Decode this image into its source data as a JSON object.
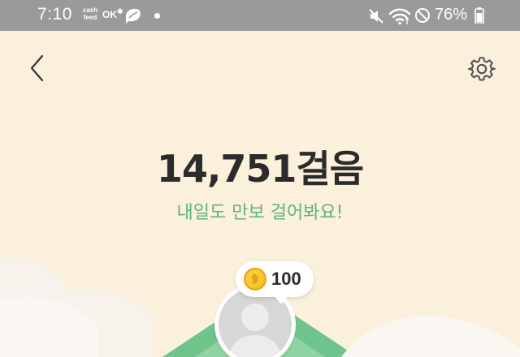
{
  "status_bar": {
    "time": "7:10",
    "cashfeed_line1": "cash",
    "cashfeed_line2": "feed",
    "ok_label": "OK",
    "battery": "76%",
    "icons": [
      "cashfeed-icon",
      "ok-cashbag-icon",
      "leaf-icon",
      "notification-dot",
      "mute-icon",
      "wifi-icon",
      "do-not-disturb-icon",
      "battery-icon"
    ]
  },
  "header": {
    "back_icon": "chevron-left-icon",
    "settings_icon": "gear-icon"
  },
  "main": {
    "steps": "14,751걸음",
    "message": "내일도 만보 걸어봐요!"
  },
  "reward": {
    "coins": "100",
    "coin_icon": "coin-icon"
  },
  "colors": {
    "background": "#fbf0dc",
    "status_bar": "#9a9a9a",
    "accent_green": "#5cb37a",
    "text_dark": "#2b2b2b",
    "coin_gold": "#f3b51b"
  }
}
